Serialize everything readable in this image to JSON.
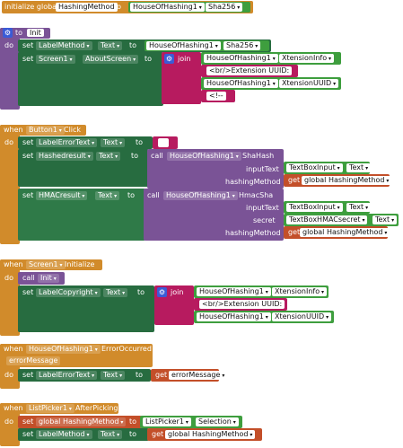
{
  "blocks": {
    "global": {
      "initialize_global": "initialize global",
      "var_name": "HashingMethod",
      "to": "to",
      "component": "HouseOfHashing1",
      "value": "Sha256"
    },
    "init_proc": {
      "to": "to",
      "name": "Init",
      "do": "do",
      "set1": {
        "set": "set",
        "component": "LabelMethod",
        "prop": "Text",
        "to": "to",
        "get_comp": "HouseOfHashing1",
        "get_prop": "Sha256"
      },
      "set2": {
        "set": "set",
        "component": "Screen1",
        "prop": "AboutScreen",
        "to": "to",
        "join": "join",
        "j1_comp": "HouseOfHashing1",
        "j1_prop": "XtensionInfo",
        "j2": "<br/>Extension UUID:",
        "j3_comp": "HouseOfHashing1",
        "j3_prop": "XtensionUUID",
        "j4": "<!--"
      }
    },
    "button_click": {
      "when": "when",
      "component": "Button1",
      "event": "Click",
      "do": "do",
      "set1": {
        "set": "set",
        "component": "LabelErrorText",
        "prop": "Text",
        "to": "to",
        "value": ""
      },
      "set2": {
        "set": "set",
        "component": "Hashedresult",
        "prop": "Text",
        "to": "to",
        "call": "call",
        "call_comp": "HouseOfHashing1",
        "method": "ShaHash",
        "arg1": "inputText",
        "arg1_comp": "TextBoxInput",
        "arg1_prop": "Text",
        "arg2": "hashingMethod",
        "get": "get",
        "arg2_var": "global HashingMethod"
      },
      "set3": {
        "set": "set",
        "component": "HMACresult",
        "prop": "Text",
        "to": "to",
        "call": "call",
        "call_comp": "HouseOfHashing1",
        "method": "HmacSha",
        "arg1": "inputText",
        "arg1_comp": "TextBoxInput",
        "arg1_prop": "Text",
        "arg2": "secret",
        "arg2_comp": "TextBoxHMACsecret",
        "arg2_prop": "Text",
        "arg3": "hashingMethod",
        "get": "get",
        "arg3_var": "global HashingMethod"
      }
    },
    "screen_init": {
      "when": "when",
      "component": "Screen1",
      "event": "Initialize",
      "do": "do",
      "call": "call",
      "proc": "Init",
      "set1": {
        "set": "set",
        "component": "LabelCopyright",
        "prop": "Text",
        "to": "to",
        "join": "join",
        "j1_comp": "HouseOfHashing1",
        "j1_prop": "XtensionInfo",
        "j2": "<br/>Extension UUID:",
        "j3_comp": "HouseOfHashing1",
        "j3_prop": "XtensionUUID"
      }
    },
    "error_occurred": {
      "when": "when",
      "component": "HouseOfHashing1",
      "event": "ErrorOccurred",
      "param": "errorMessage",
      "do": "do",
      "set1": {
        "set": "set",
        "component": "LabelErrorText",
        "prop": "Text",
        "to": "to",
        "get": "get",
        "var": "errorMessage"
      }
    },
    "after_picking": {
      "when": "when",
      "component": "ListPicker1",
      "event": "AfterPicking",
      "do": "do",
      "set1": {
        "set": "set",
        "var": "global HashingMethod",
        "to": "to",
        "component": "ListPicker1",
        "prop": "Selection"
      },
      "set2": {
        "set": "set",
        "component": "LabelMethod",
        "prop": "Text",
        "to": "to",
        "get": "get",
        "var": "global HashingMethod"
      }
    }
  },
  "colors": {
    "event": "#d18b2b",
    "procedure": "#7a5396",
    "component_set": "#276c40",
    "component_get": "#3e9e3e",
    "text": "#b71b5f",
    "variable": "#c34f29"
  }
}
